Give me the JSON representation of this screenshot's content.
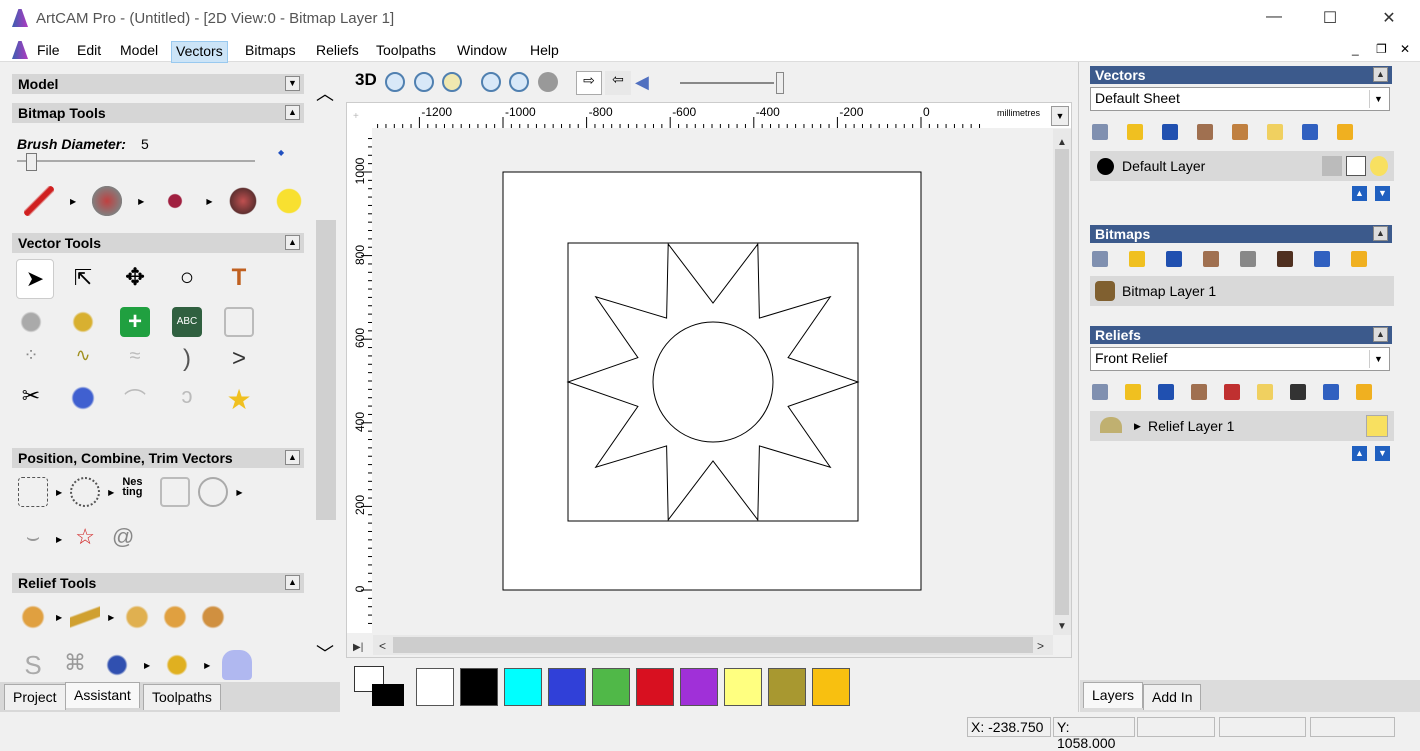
{
  "window": {
    "title": "ArtCAM Pro - (Untitled) - [2D View:0 - Bitmap Layer 1]",
    "minimize": "—",
    "maximize": "☐",
    "close": "✕"
  },
  "menu": [
    "File",
    "Edit",
    "Model",
    "Vectors",
    "Bitmaps",
    "Reliefs",
    "Toolpaths",
    "Window",
    "Help"
  ],
  "menu_active": "Vectors",
  "left_panel": {
    "sections": {
      "model": "Model",
      "bitmap_tools": "Bitmap Tools",
      "vector_tools": "Vector Tools",
      "position": "Position, Combine, Trim Vectors",
      "relief_tools": "Relief Tools"
    },
    "brush_label": "Brush Diameter:",
    "brush_value": "5",
    "brush_slider_fraction": 0.05,
    "tabs": [
      "Project",
      "Assistant",
      "Toolpaths"
    ],
    "active_tab": "Assistant"
  },
  "view_toolbar": {
    "label_3d": "3D"
  },
  "ruler": {
    "h_labels": [
      "-1200",
      "-1000",
      "-800",
      "-600",
      "-400",
      "-200",
      "0"
    ],
    "units": "millimetres",
    "v_labels": [
      "1000",
      "800",
      "600",
      "400",
      "200",
      "0"
    ]
  },
  "palette": {
    "colors": [
      "#ffffff",
      "#000000",
      "#00ffff",
      "#3040d8",
      "#50b848",
      "#d81020",
      "#a030d8",
      "#ffff80",
      "#a89830",
      "#f8c010"
    ]
  },
  "right_panel": {
    "vectors": {
      "title": "Vectors",
      "sheet": "Default Sheet",
      "layer": "Default Layer"
    },
    "bitmaps": {
      "title": "Bitmaps",
      "layer": "Bitmap Layer 1"
    },
    "reliefs": {
      "title": "Reliefs",
      "sheet": "Front Relief",
      "layer": "Relief Layer 1"
    },
    "tabs": [
      "Layers",
      "Add In"
    ],
    "active_tab": "Layers"
  },
  "status": {
    "x": "X: -238.750",
    "y": "Y: 1058.000"
  }
}
